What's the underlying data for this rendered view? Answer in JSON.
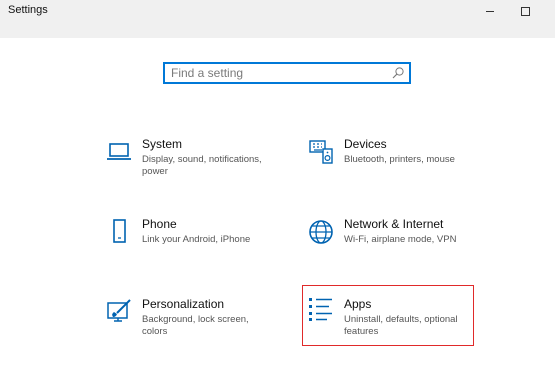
{
  "window": {
    "title": "Settings"
  },
  "search": {
    "placeholder": "Find a setting"
  },
  "categories": [
    {
      "name": "System",
      "description": "Display, sound, notifications, power"
    },
    {
      "name": "Devices",
      "description": "Bluetooth, printers, mouse"
    },
    {
      "name": "Phone",
      "description": "Link your Android, iPhone"
    },
    {
      "name": "Network & Internet",
      "description": "Wi-Fi, airplane mode, VPN"
    },
    {
      "name": "Personalization",
      "description": "Background, lock screen, colors"
    },
    {
      "name": "Apps",
      "description": "Uninstall, defaults, optional features"
    }
  ],
  "colors": {
    "accent": "#0078d7",
    "highlight_border": "#e02a2a"
  }
}
